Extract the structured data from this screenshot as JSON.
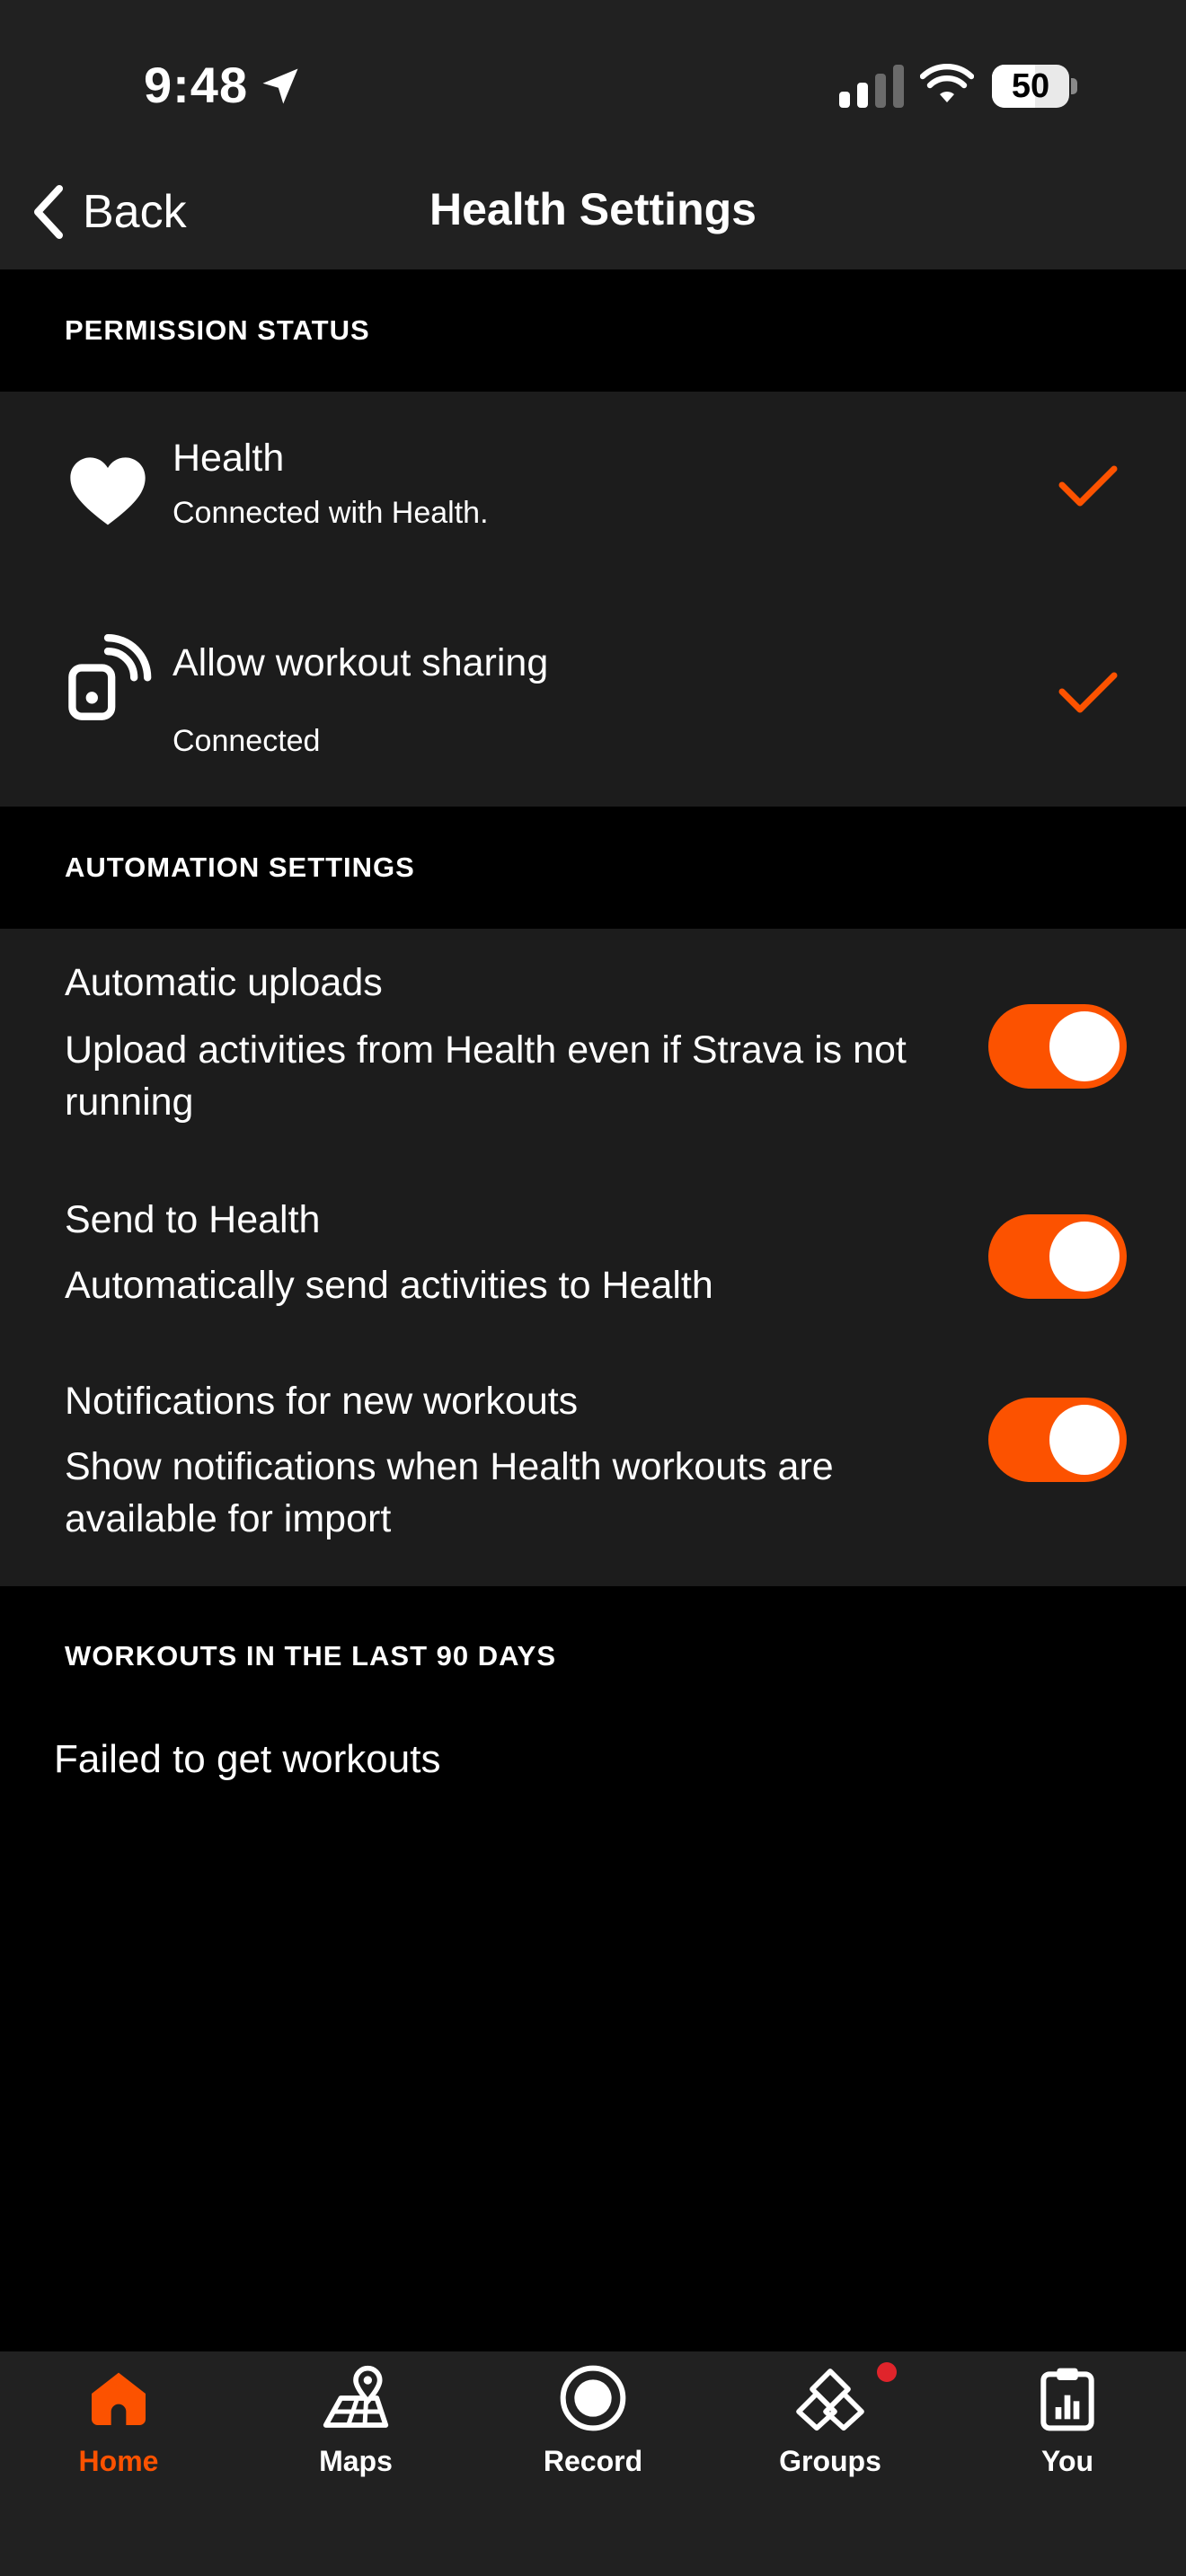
{
  "status_bar": {
    "time": "9:48",
    "battery": "50"
  },
  "nav": {
    "back_label": "Back",
    "title": "Health Settings"
  },
  "sections": {
    "permission": "PERMISSION STATUS",
    "automation": "AUTOMATION SETTINGS",
    "workouts": "WORKOUTS IN THE LAST 90 DAYS"
  },
  "permissions": [
    {
      "title": "Health",
      "subtitle": "Connected with Health.",
      "icon": "heart-icon",
      "status": "checked"
    },
    {
      "title": "Allow workout sharing",
      "subtitle": "Connected",
      "icon": "workout-sharing-icon",
      "status": "checked"
    }
  ],
  "automation": [
    {
      "title": "Automatic uploads",
      "description": "Upload activities from Health even if Strava is not running",
      "enabled": true
    },
    {
      "title": "Send to Health",
      "description": "Automatically send activities to Health",
      "enabled": true
    },
    {
      "title": "Notifications for new workouts",
      "description": "Show notifications when Health workouts are available for import",
      "enabled": true
    }
  ],
  "workouts": {
    "message": "Failed to get workouts"
  },
  "tabbar": {
    "active": "Home",
    "items": [
      {
        "label": "Home",
        "icon": "home-icon"
      },
      {
        "label": "Maps",
        "icon": "map-icon"
      },
      {
        "label": "Record",
        "icon": "record-icon"
      },
      {
        "label": "Groups",
        "icon": "groups-icon",
        "badge": true
      },
      {
        "label": "You",
        "icon": "clipboard-stats-icon"
      }
    ]
  },
  "colors": {
    "accent": "#fc5200",
    "panel": "#1c1c1c",
    "bar": "#212121",
    "badge": "#e0242b"
  }
}
